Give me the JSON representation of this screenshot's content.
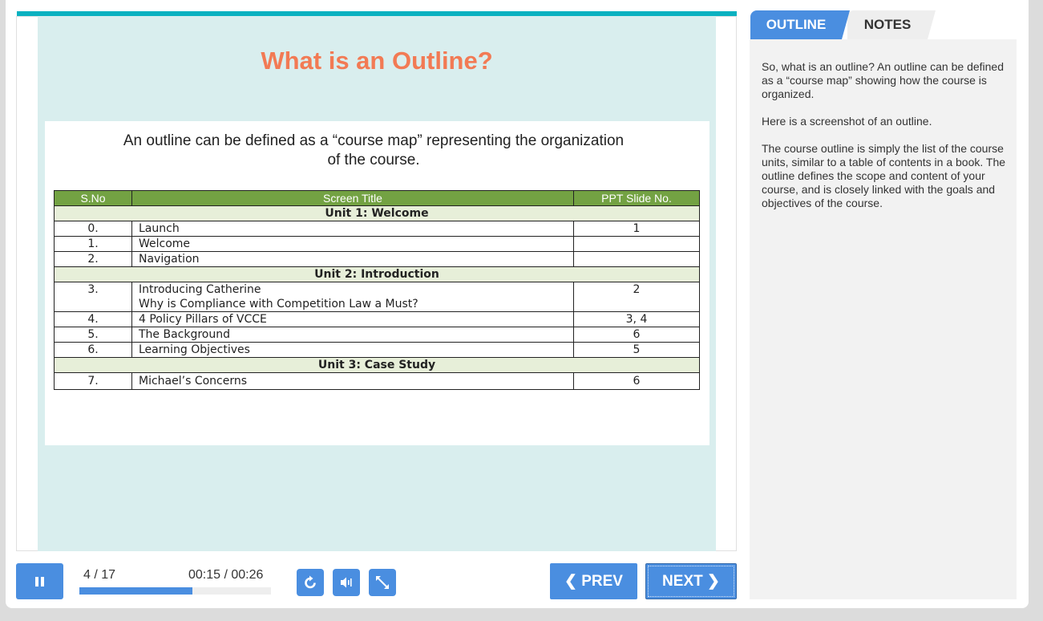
{
  "slide": {
    "title": "What is an Outline?",
    "intro_line1": "An outline can be defined as a “course map” representing the organization",
    "intro_line2": "of the course.",
    "table": {
      "headers": [
        "S.No",
        "Screen Title",
        "PPT Slide No."
      ],
      "units": [
        {
          "name": "Unit 1: Welcome",
          "rows": [
            {
              "sno": "0.",
              "title": "Launch",
              "slide": "1"
            },
            {
              "sno": "1.",
              "title": "Welcome",
              "slide": ""
            },
            {
              "sno": "2.",
              "title": "Navigation",
              "slide": ""
            }
          ]
        },
        {
          "name": "Unit 2: Introduction",
          "rows": [
            {
              "sno": "3.",
              "title": "Introducing Catherine",
              "title2": "Why is Compliance with Competition Law a Must?",
              "slide": "2"
            },
            {
              "sno": "4.",
              "title": "4 Policy Pillars of VCCE",
              "slide": "3, 4"
            },
            {
              "sno": "5.",
              "title": "The Background",
              "slide": "6"
            },
            {
              "sno": "6.",
              "title": "Learning Objectives",
              "slide": "5"
            }
          ]
        },
        {
          "name": "Unit 3: Case Study",
          "rows": [
            {
              "sno": "7.",
              "title": "Michael’s Concerns",
              "slide": "6"
            }
          ]
        }
      ]
    }
  },
  "tabs": {
    "outline": "OUTLINE",
    "notes": "NOTES"
  },
  "notes": {
    "p1": "So, what is an outline? An outline can be defined as a “course map” showing how the course is organized.",
    "p2": "Here is a screenshot of an outline.",
    "p3": "The course outline is simply the list of the course units, similar to a table of contents in a book. The outline defines the scope and content of your course, and is  closely linked with the goals and objectives of the course."
  },
  "player": {
    "progress": "4 / 17",
    "progress_fraction": 0.59,
    "time": "00:15 / 00:26",
    "prev_label": "PREV",
    "next_label": "NEXT",
    "icons": [
      "pause-icon",
      "replay-icon",
      "volume-icon",
      "fullscreen-icon"
    ],
    "accent_color": "#4a8ee0",
    "title_color": "#f27a54"
  }
}
